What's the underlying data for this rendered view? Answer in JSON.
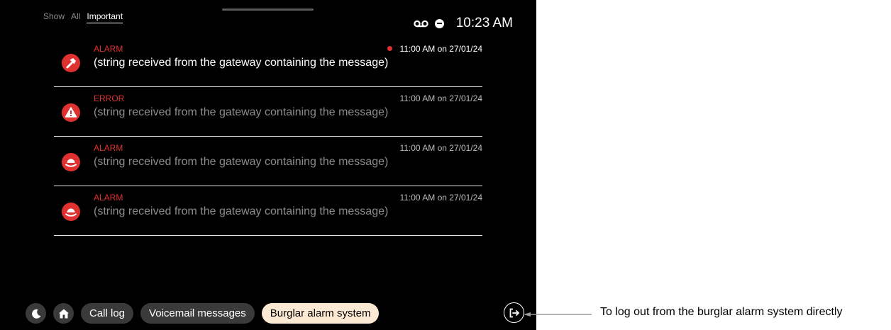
{
  "filter": {
    "show_label": "Show",
    "all_label": "All",
    "important_label": "Important"
  },
  "status": {
    "time": "10:23 AM",
    "icons": [
      "voicemail-icon",
      "do-not-disturb-icon"
    ]
  },
  "notifications": [
    {
      "category": "ALARM",
      "timestamp": "11:00 AM on 27/01/24",
      "message": "(string received from the gateway containing the message)",
      "icon": "hammer-icon",
      "unread": true
    },
    {
      "category": "ERROR",
      "timestamp": "11:00 AM on 27/01/24",
      "message": "(string received from the gateway containing the message)",
      "icon": "warning-icon",
      "unread": false
    },
    {
      "category": "ALARM",
      "timestamp": "11:00 AM on 27/01/24",
      "message": "(string received from the gateway containing the message)",
      "icon": "siren-icon",
      "unread": false
    },
    {
      "category": "ALARM",
      "timestamp": "11:00 AM on 27/01/24",
      "message": "(string received from the gateway containing the message)",
      "icon": "siren-icon",
      "unread": false
    }
  ],
  "bottom_bar": {
    "call_log": "Call log",
    "voicemail": "Voicemail messages",
    "burglar": "Burglar alarm system",
    "icons": [
      "moon-icon",
      "home-icon",
      "logout-icon"
    ]
  },
  "annotation": "To log out from the burglar alarm system directly",
  "colors": {
    "alarm_red": "#e03131",
    "active_pill": "#fbe9d3",
    "chip": "#3a3a3a"
  }
}
